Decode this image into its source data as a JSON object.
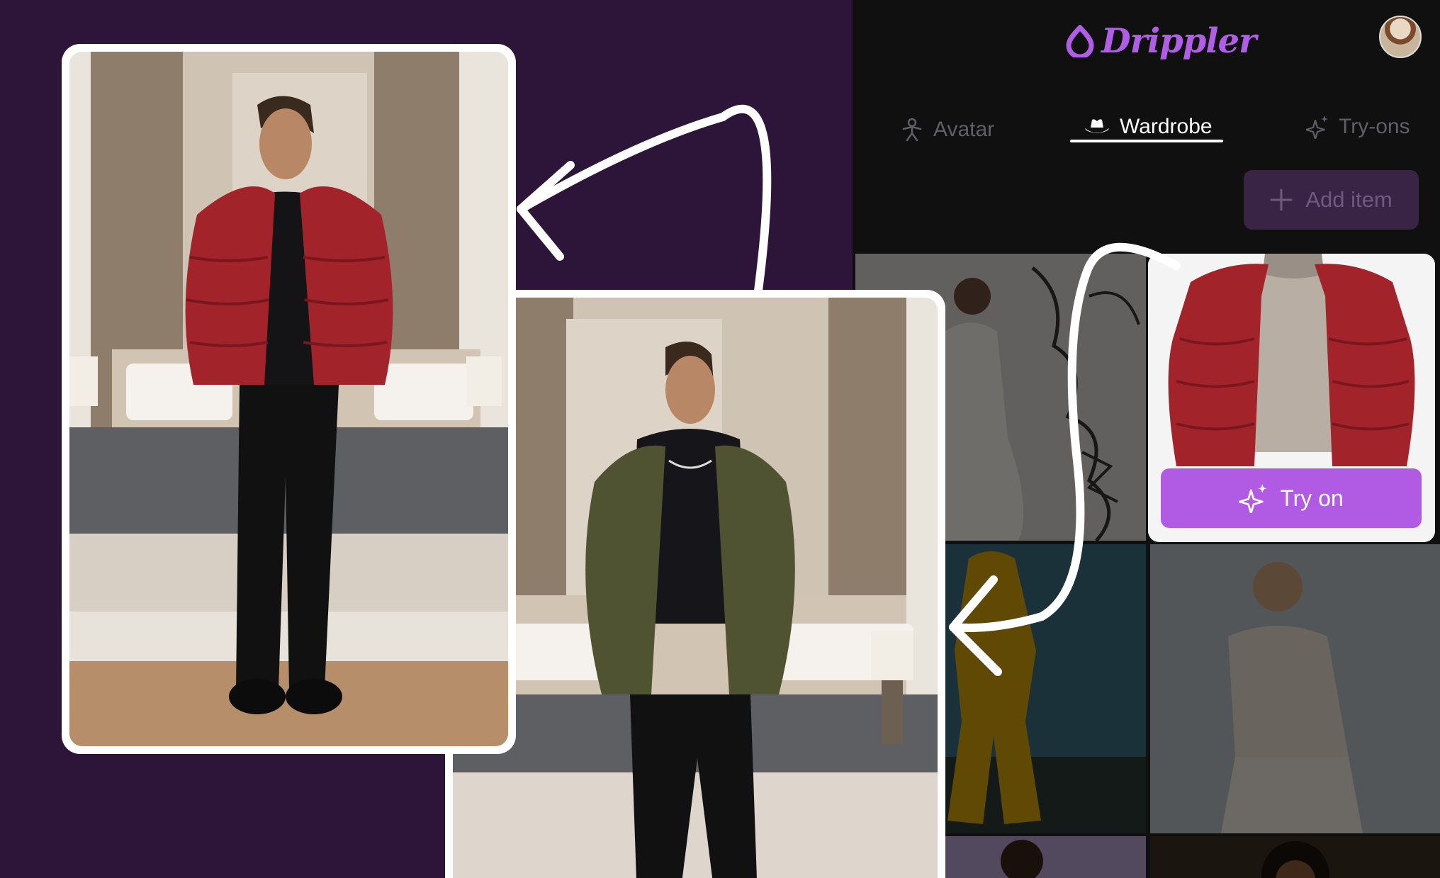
{
  "app": {
    "brand": "Drippler",
    "tabs": [
      {
        "label": "Avatar",
        "icon": "person-icon"
      },
      {
        "label": "Wardrobe",
        "icon": "hat-icon"
      },
      {
        "label": "Try-ons",
        "icon": "sparkles-icon"
      }
    ],
    "active_tab": "Wardrobe",
    "add_item_label": "Add item",
    "try_on_label": "Try on"
  },
  "colors": {
    "brand_purple": "#b05ee6",
    "promo_background": "#2c1538",
    "app_background": "#101010",
    "add_button_bg": "#3a2446"
  }
}
